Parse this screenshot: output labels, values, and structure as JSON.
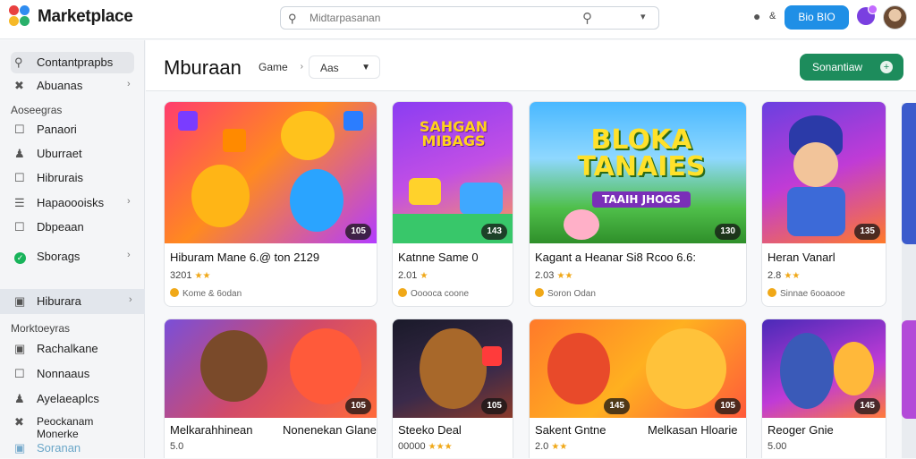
{
  "app": {
    "title": "Marketplace"
  },
  "header": {
    "search_placeholder": "Midtarpasanan",
    "notif_count": "&",
    "button_label": "Bio  BIO"
  },
  "sidebar": {
    "top_items": [
      {
        "label": "Contantprapbs",
        "icon": "search-icon"
      },
      {
        "label": "Abuanas",
        "icon": "tag-icon"
      }
    ],
    "section1": "Aoseegras",
    "section1_items": [
      {
        "label": "Panaori",
        "icon": "document-icon"
      },
      {
        "label": "Uburraet",
        "icon": "user-icon"
      },
      {
        "label": "Hibrurais",
        "icon": "document-icon"
      },
      {
        "label": "Hapaoooisks",
        "icon": "list-icon"
      },
      {
        "label": "Dbpeaan",
        "icon": "document-icon"
      },
      {
        "label": "Sborags",
        "icon": "check-icon"
      }
    ],
    "highlight_item": {
      "label": "Hiburara"
    },
    "section2": "Morktoeyras",
    "section2_items": [
      {
        "label": "Rachalkane",
        "icon": "box-icon"
      },
      {
        "label": "Nonnaaus",
        "icon": "document-icon"
      },
      {
        "label": "Ayelaeaplcs",
        "icon": "user-icon"
      },
      {
        "label": "Peockanam Monerke",
        "icon": "tag-icon"
      },
      {
        "label": "Soranan",
        "icon": "box-icon"
      }
    ]
  },
  "main": {
    "page_title": "Mburaan",
    "filter_label": "Game",
    "sort_label": "Aas",
    "primary_button": "Sonantiaw"
  },
  "cards": [
    {
      "title": "Hiburam Mane 6.@ ton 2129",
      "meta": "3201",
      "sub": "Kome & 6odan",
      "badge": "105"
    },
    {
      "title": "Katnne Same 0",
      "meta": "2.01",
      "sub": "Ooooca coone",
      "badge": "143",
      "banner": "SAHGAN MIBAGS"
    },
    {
      "title": "Kagant a Heanar Si8 Rcoo 6.6:",
      "meta": "2.03",
      "sub": "Soron Odan",
      "badge": "130",
      "banner": "BLOKA TANAIES",
      "banner_sub": "TAAIH JHOGS"
    },
    {
      "title": "Heran Vanarl",
      "meta": "2.8",
      "sub": "Sinnae 6ooaooe",
      "badge": "135"
    },
    {
      "title": "Melkarahhinean",
      "title2": "Nonenekan Glane",
      "meta": "5.0",
      "badge": "105"
    },
    {
      "title": "Steeko Deal",
      "meta": "00000",
      "badge": "105"
    },
    {
      "title": "Sakent Gntne",
      "title2": "Melkasan Hloarie",
      "meta": "2.0",
      "badge": "145",
      "badge2": "105"
    },
    {
      "title": "Reoger Gnie",
      "meta": "5.00",
      "badge": "145"
    }
  ]
}
